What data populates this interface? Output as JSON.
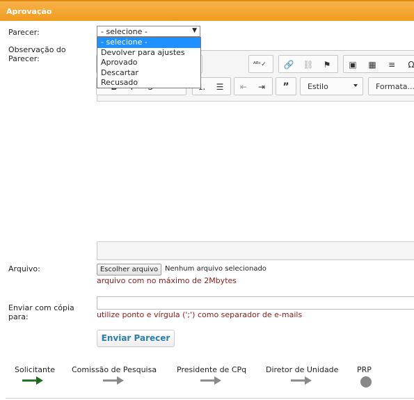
{
  "header": {
    "title": "Aprovação"
  },
  "form": {
    "parecer_label": "Parecer:",
    "parecer_selected": "- selecione -",
    "parecer_options": [
      "- selecione -",
      "Devolver para ajustes",
      "Aprovado",
      "Descartar",
      "Recusado"
    ],
    "observacao_label_1": "Observação do",
    "observacao_label_2": "Parecer:",
    "editor": {
      "style_label": "Estilo",
      "format_label": "Formata..."
    },
    "arquivo_label": "Arquivo:",
    "file_button": "Escolher arquivo",
    "file_status": "Nenhum arquivo selecionado",
    "file_hint": "arquivo com no máximo de 2Mbytes",
    "copia_label_1": "Enviar com cópia",
    "copia_label_2": "para:",
    "copia_value": "",
    "copia_hint": "utilize ponto e vírgula (';') como separador de e-mails",
    "submit_label": "Enviar Parecer"
  },
  "workflow": {
    "steps": [
      "Solicitante",
      "Comissão de Pesquisa",
      "Presidente de CPq",
      "Diretor de Unidade",
      "PRP"
    ],
    "colors": {
      "active": "#1f6b1f",
      "inactive": "#8a8a8a"
    }
  }
}
